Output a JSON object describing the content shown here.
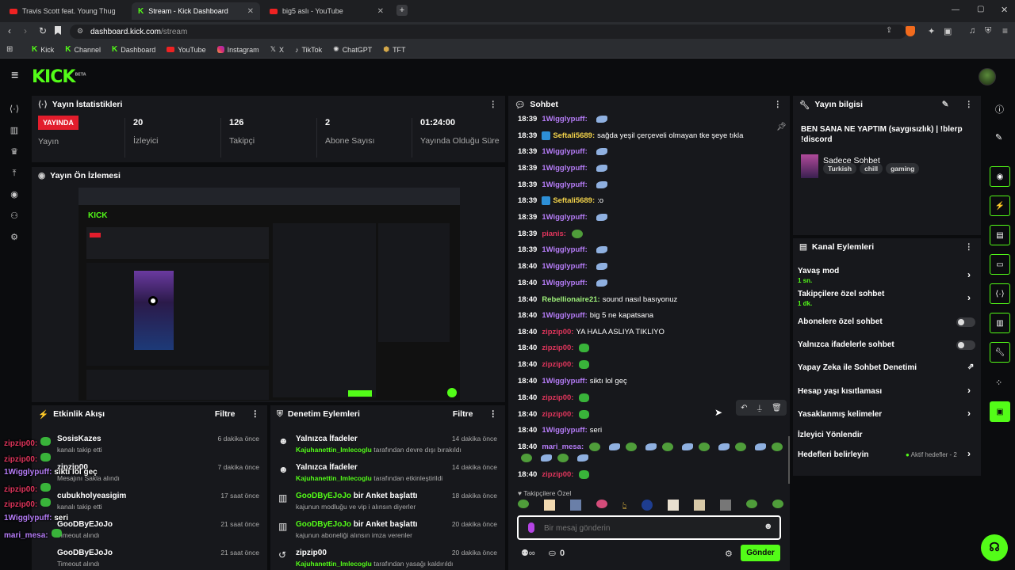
{
  "browser": {
    "tabs": [
      {
        "title": "Travis Scott feat. Young Thug & M.I.A",
        "icon": "youtube-icon"
      },
      {
        "title": "Stream - Kick Dashboard",
        "icon": "kick-icon"
      },
      {
        "title": "big5 aslı - YouTube",
        "icon": "youtube-icon"
      }
    ],
    "url_host": "dashboard.kick.com",
    "url_path": "/stream",
    "bookmarks": [
      "Kick",
      "Channel",
      "Dashboard",
      "YouTube",
      "Instagram",
      "X",
      "TikTok",
      "ChatGPT",
      "TFT"
    ]
  },
  "brand": {
    "logo": "KICK",
    "badge": "BETA",
    "accent": "#53fc18"
  },
  "stats": {
    "title": "Yayın İstatistikleri",
    "live_badge": "YAYINDA",
    "items": [
      {
        "value": "",
        "label": "Yayın"
      },
      {
        "value": "20",
        "label": "İzleyici"
      },
      {
        "value": "126",
        "label": "Takipçi"
      },
      {
        "value": "2",
        "label": "Abone Sayısı"
      },
      {
        "value": "01:24:00",
        "label": "Yayında Olduğu Süre"
      }
    ]
  },
  "preview": {
    "title": "Yayın Ön İzlemesi"
  },
  "activity": {
    "title": "Etkinlik Akışı",
    "filter": "Filtre",
    "items": [
      {
        "name": "SosisKazes",
        "sub": "kanalı takip etti",
        "time": "6 dakika önce"
      },
      {
        "name": "zipzip00",
        "sub": "Mesajını Sakla alındı",
        "time": "7 dakika önce"
      },
      {
        "name": "cubukholyeasigim",
        "sub": "kanalı takip etti",
        "time": "17 saat önce"
      },
      {
        "name": "GooDByEJoJo",
        "sub": "Timeout alındı",
        "time": "21 saat önce"
      },
      {
        "name": "GooDByEJoJo",
        "sub": "Timeout alındı",
        "time": "21 saat önce"
      }
    ]
  },
  "moderation": {
    "title": "Denetim Eylemleri",
    "filter": "Filtre",
    "items": [
      {
        "title": "Yalnızca İfadeler",
        "actor": "Kajuhanettin_Imlecoglu",
        "sub": "tarafından devre dışı bırakıldı",
        "time": "14 dakika önce"
      },
      {
        "title": "Yalnızca İfadeler",
        "actor": "Kajuhanettin_Imlecoglu",
        "sub": "tarafından etkinleştirildi",
        "time": "14 dakika önce"
      },
      {
        "actor_top": "GooDByEJoJo",
        "title": "bir Anket başlattı",
        "actor": "",
        "sub": "kajunun modluğu ve vip i alınsın diyerler",
        "time": "18 dakika önce"
      },
      {
        "actor_top": "GooDByEJoJo",
        "title": "bir Anket başlattı",
        "actor": "",
        "sub": "kajunun aboneliği alınsın imza verenler",
        "time": "20 dakika önce"
      },
      {
        "title": "zipzip00",
        "actor": "Kajuhanettin_Imlecoglu",
        "sub": "tarafından yasağı kaldırıldı",
        "time": "20 dakika önce"
      }
    ]
  },
  "chat": {
    "title": "Sohbet",
    "messages": [
      {
        "time": "18:39",
        "user": "1Wigglypuff:",
        "color": "#b57cf7",
        "text": "",
        "emotes": [
          "dm"
        ]
      },
      {
        "time": "18:39",
        "user": "Seftali5689:",
        "color": "#f3d34a",
        "text": "sağda yeşil çerçeveli olmayan tke şeye tıkla",
        "emotes": [],
        "badge": true
      },
      {
        "time": "18:39",
        "user": "1Wigglypuff:",
        "color": "#b57cf7",
        "text": "",
        "emotes": [
          "dm"
        ]
      },
      {
        "time": "18:39",
        "user": "1Wigglypuff:",
        "color": "#b57cf7",
        "text": "",
        "emotes": [
          "dm"
        ]
      },
      {
        "time": "18:39",
        "user": "1Wigglypuff:",
        "color": "#b57cf7",
        "text": "",
        "emotes": [
          "dm"
        ]
      },
      {
        "time": "18:39",
        "user": "Seftali5689:",
        "color": "#f3d34a",
        "text": ":o",
        "emotes": [],
        "badge": true
      },
      {
        "time": "18:39",
        "user": "1Wigglypuff:",
        "color": "#b57cf7",
        "text": "",
        "emotes": [
          "dm"
        ]
      },
      {
        "time": "18:39",
        "user": "pianis:",
        "color": "#e0355c",
        "text": "",
        "emotes": [
          "pepe"
        ]
      },
      {
        "time": "18:39",
        "user": "1Wigglypuff:",
        "color": "#b57cf7",
        "text": "",
        "emotes": [
          "dm"
        ]
      },
      {
        "time": "18:40",
        "user": "1Wigglypuff:",
        "color": "#b57cf7",
        "text": "",
        "emotes": [
          "dm"
        ]
      },
      {
        "time": "18:40",
        "user": "1Wigglypuff:",
        "color": "#b57cf7",
        "text": "",
        "emotes": [
          "dm"
        ]
      },
      {
        "time": "18:40",
        "user": "Rebellionaire21:",
        "color": "#9ef07a",
        "text": "sound nasıl basıyonuz",
        "emotes": []
      },
      {
        "time": "18:40",
        "user": "1Wigglypuff:",
        "color": "#b57cf7",
        "text": "big 5 ne kapatsana",
        "emotes": []
      },
      {
        "time": "18:40",
        "user": "zipzip00:",
        "color": "#e0355c",
        "text": "YA HALA ASLIYA TIKLIYO",
        "emotes": []
      },
      {
        "time": "18:40",
        "user": "zipzip00:",
        "color": "#e0355c",
        "text": "",
        "emotes": [
          "gp"
        ]
      },
      {
        "time": "18:40",
        "user": "zipzip00:",
        "color": "#e0355c",
        "text": "",
        "emotes": [
          "gp"
        ]
      },
      {
        "time": "18:40",
        "user": "1Wigglypuff:",
        "color": "#b57cf7",
        "text": "siktı lol geç",
        "emotes": []
      },
      {
        "time": "18:40",
        "user": "zipzip00:",
        "color": "#e0355c",
        "text": "",
        "emotes": [
          "gp"
        ]
      },
      {
        "time": "18:40",
        "user": "zipzip00:",
        "color": "#e0355c",
        "text": "",
        "emotes": [
          "gp"
        ]
      },
      {
        "time": "18:40",
        "user": "1Wigglypuff:",
        "color": "#b57cf7",
        "text": "seri",
        "emotes": []
      },
      {
        "time": "18:40",
        "user": "mari_mesa:",
        "color": "#b57cf7",
        "text": "",
        "emotes": [
          "pepe",
          "dm",
          "pepe",
          "dm",
          "pepe",
          "dm",
          "pepe",
          "dm",
          "pepe",
          "dm",
          "pepe"
        ]
      },
      {
        "time": "",
        "user": "",
        "color": "#fff",
        "text": "",
        "emotes": [
          "pepe",
          "dm",
          "pepe",
          "dm"
        ]
      },
      {
        "time": "18:40",
        "user": "zipzip00:",
        "color": "#e0355c",
        "text": "",
        "emotes": [
          "gp"
        ]
      }
    ],
    "followers_only": "Takipçilere Özel",
    "input_placeholder": "Bir mesaj gönderin",
    "count": "0",
    "send": "Gönder"
  },
  "stream_info": {
    "title": "Yayın bilgisi",
    "stream_title": "BEN SANA NE YAPTIM (saygısızlık) | !blerp !discord",
    "category": "Sadece Sohbet",
    "tags": [
      "Turkish",
      "chill",
      "gaming"
    ]
  },
  "channel_actions": {
    "title": "Kanal Eylemleri",
    "items": [
      {
        "label": "Yavaş mod",
        "sub": "1 sn.",
        "control": "chevron"
      },
      {
        "label": "Takipçilere özel sohbet",
        "sub": "1 dk.",
        "control": "chevron"
      },
      {
        "label": "Abonelere özel sohbet",
        "sub": "",
        "control": "toggle"
      },
      {
        "label": "Yalnızca ifadelerle sohbet",
        "sub": "",
        "control": "toggle"
      },
      {
        "label": "Yapay Zeka ile Sohbet Denetimi",
        "sub": "",
        "control": "external"
      },
      {
        "label": "Hesap yaşı kısıtlaması",
        "sub": "",
        "control": "chevron"
      },
      {
        "label": "Yasaklanmış kelimeler",
        "sub": "",
        "control": "chevron"
      },
      {
        "label": "İzleyici Yönlendir",
        "sub": "",
        "control": "none"
      },
      {
        "label": "Hedefleri belirleyin",
        "sub": "",
        "control": "chevron",
        "status": "Aktif hedefler - 2"
      }
    ]
  },
  "overlay_chat": [
    {
      "user": "zipzip00:",
      "text": "",
      "color": "#e0355c"
    },
    {
      "user": "zipzip00:",
      "text": "",
      "color": "#e0355c"
    },
    {
      "user": "1Wigglypuff:",
      "text": "siktı lol geç",
      "color": "#b57cf7"
    },
    {
      "user": "zipzip00:",
      "text": "",
      "color": "#e0355c"
    },
    {
      "user": "zipzip00:",
      "text": "",
      "color": "#e0355c"
    },
    {
      "user": "1Wigglypuff:",
      "text": "seri",
      "color": "#b57cf7"
    },
    {
      "user": "mari_mesa:",
      "text": "",
      "color": "#b57cf7"
    }
  ]
}
